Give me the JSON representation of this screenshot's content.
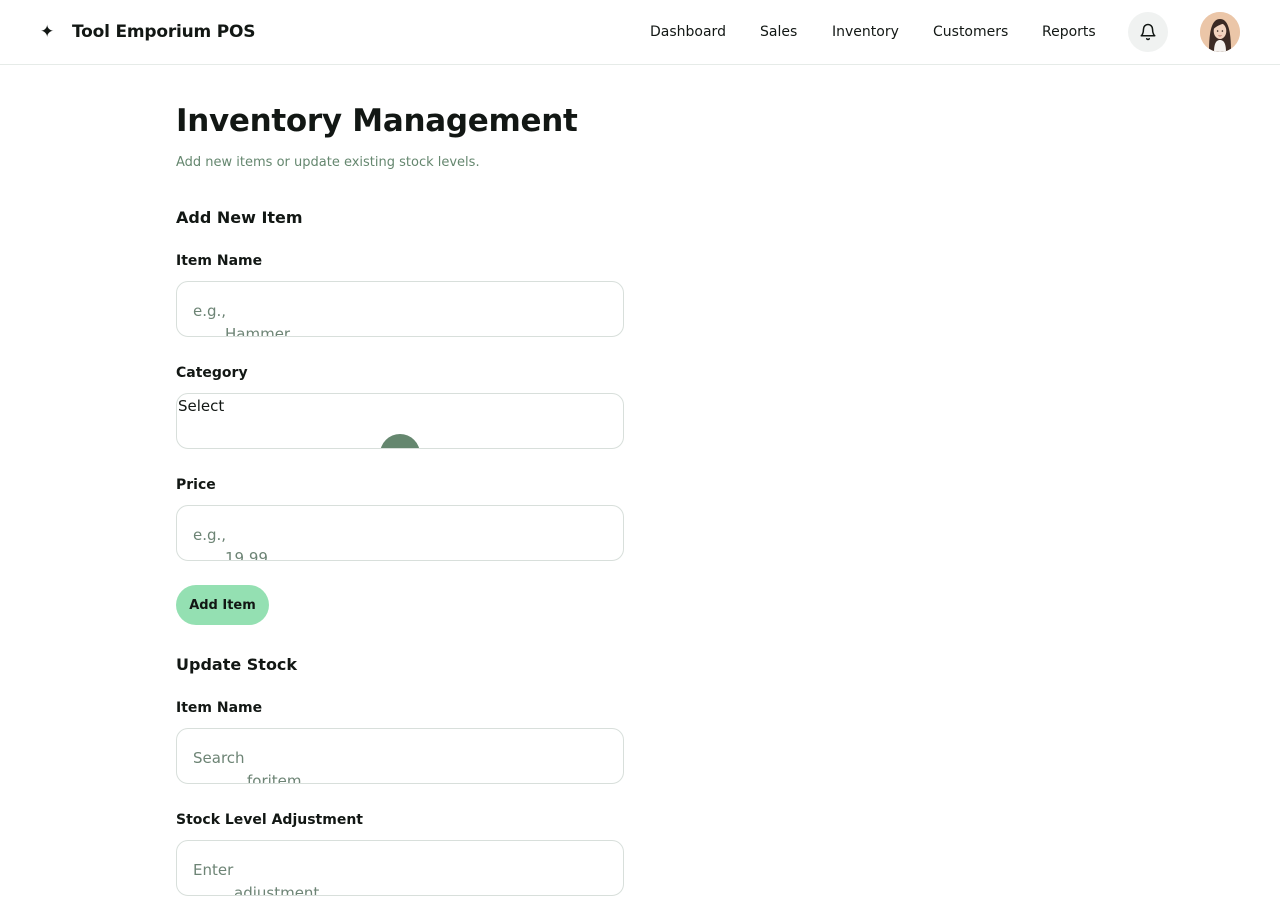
{
  "header": {
    "brand_icon": "✦",
    "brand_title": "Tool Emporium POS",
    "nav": [
      {
        "label": "Dashboard"
      },
      {
        "label": "Sales"
      },
      {
        "label": "Inventory"
      },
      {
        "label": "Customers"
      },
      {
        "label": "Reports"
      }
    ],
    "notification_icon": "bell-icon",
    "avatar": "user-avatar"
  },
  "page": {
    "title": "Inventory Management",
    "subtitle": "Add new items or update existing stock levels."
  },
  "add_item": {
    "section_title": "Add New Item",
    "name_label": "Item Name",
    "name_placeholder": [
      "e.g.,",
      "Hammer"
    ],
    "category_label": "Category",
    "category_value": "Select",
    "price_label": "Price",
    "price_placeholder": [
      "e.g.,",
      "19.99"
    ],
    "submit_label": "Add Item"
  },
  "update_stock": {
    "section_title": "Update Stock",
    "name_label": "Item Name",
    "name_placeholder": [
      "Search",
      "foritem"
    ],
    "adjust_label": "Stock Level Adjustment",
    "adjust_placeholder": [
      "Enter",
      "adjustment"
    ]
  },
  "colors": {
    "accent": "#94e0b2",
    "muted_text": "#65876f",
    "border": "#d8dfdb",
    "text": "#121714"
  }
}
